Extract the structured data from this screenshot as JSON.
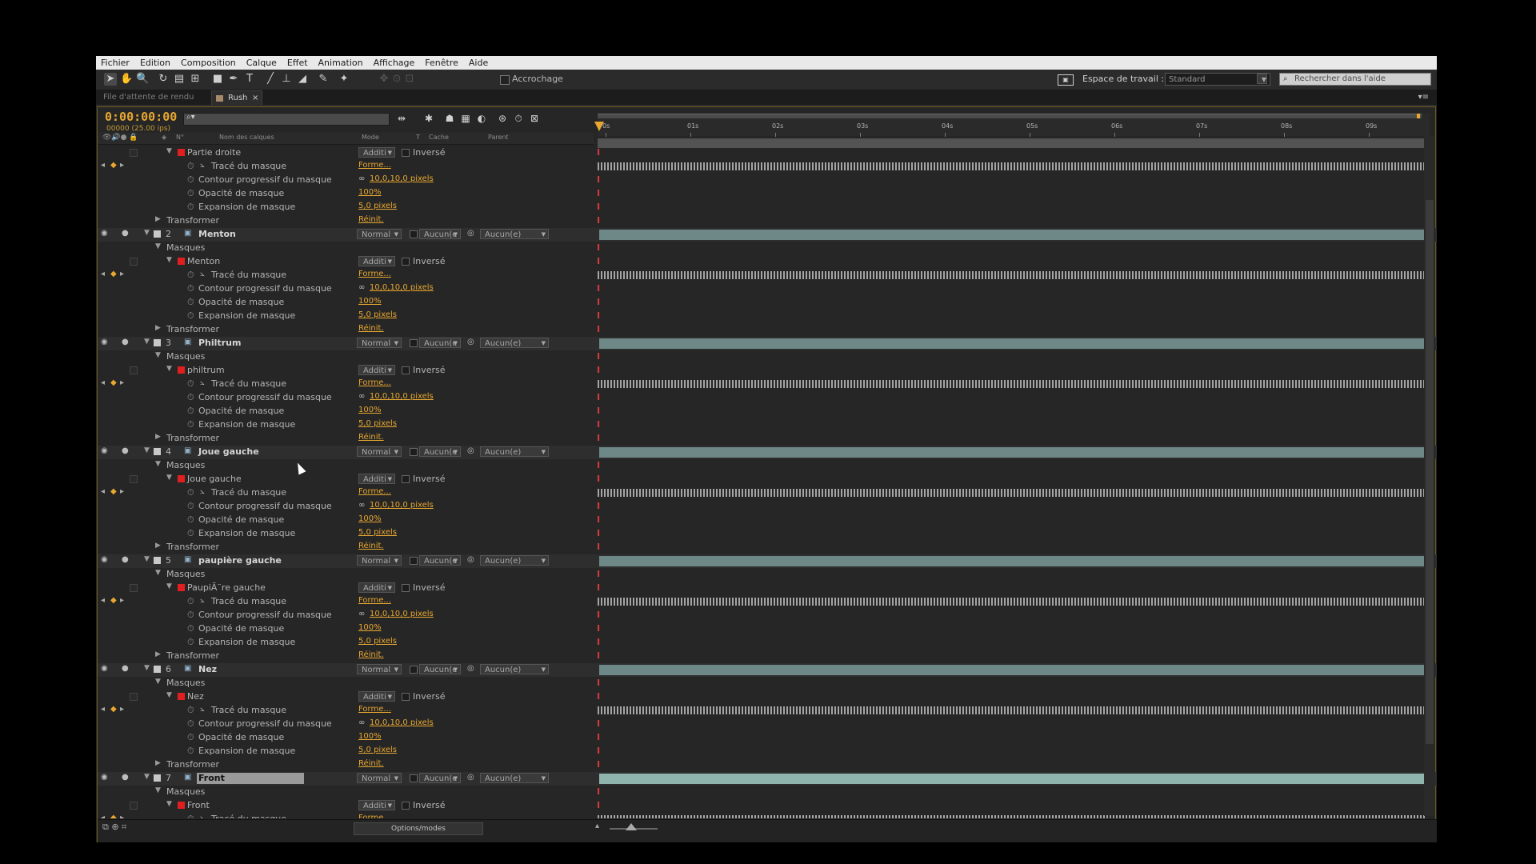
{
  "menu": [
    "Fichier",
    "Edition",
    "Composition",
    "Calque",
    "Effet",
    "Animation",
    "Affichage",
    "Fenêtre",
    "Aide"
  ],
  "toolbar": {
    "snap_label": "Accrochage",
    "workspace_label": "Espace de travail :",
    "workspace_value": "Standard",
    "search_placeholder": "Rechercher dans l'aide"
  },
  "tabs": {
    "render_queue": "File d'attente de rendu",
    "comp": "Rush",
    "close": "×"
  },
  "panel": {
    "timecode": "0:00:00:00",
    "fps": "00000 (25.00 ips)",
    "search_glyph": "⌕▾",
    "columns": {
      "num": "N°",
      "name": "Nom des calques",
      "mode": "Mode",
      "t": "T",
      "mask": "Cache",
      "parent": "Parent"
    },
    "ruler": [
      "0s",
      "01s",
      "02s",
      "03s",
      "04s",
      "05s",
      "06s",
      "07s",
      "08s",
      "09s"
    ],
    "options": "Options/modes"
  },
  "rows": [
    {
      "t": "mask",
      "name": "Partie droite",
      "mode": "Additi",
      "inv": "Inversé"
    },
    {
      "t": "path",
      "name": "Tracé du masque",
      "val": "Forme..."
    },
    {
      "t": "prop",
      "name": "Contour progressif du masque",
      "val": "10,0,10,0 pixels",
      "link": true
    },
    {
      "t": "prop",
      "name": "Opacité de masque",
      "val": "100%"
    },
    {
      "t": "prop",
      "name": "Expansion de masque",
      "val": "5,0 pixels"
    },
    {
      "t": "xf",
      "name": "Transformer",
      "val": "Réinit."
    },
    {
      "t": "layer",
      "num": "2",
      "name": "Menton",
      "mode": "Normal",
      "mask": "Aucun(e",
      "parent": "Aucun(e)"
    },
    {
      "t": "masks",
      "name": "Masques"
    },
    {
      "t": "mask",
      "name": "Menton",
      "mode": "Additi",
      "inv": "Inversé"
    },
    {
      "t": "path",
      "name": "Tracé du masque",
      "val": "Forme..."
    },
    {
      "t": "prop",
      "name": "Contour progressif du masque",
      "val": "10,0,10,0 pixels",
      "link": true
    },
    {
      "t": "prop",
      "name": "Opacité de masque",
      "val": "100%"
    },
    {
      "t": "prop",
      "name": "Expansion de masque",
      "val": "5,0 pixels"
    },
    {
      "t": "xf",
      "name": "Transformer",
      "val": "Réinit."
    },
    {
      "t": "layer",
      "num": "3",
      "name": "Philtrum",
      "mode": "Normal",
      "mask": "Aucun(e",
      "parent": "Aucun(e)"
    },
    {
      "t": "masks",
      "name": "Masques"
    },
    {
      "t": "mask",
      "name": "philtrum",
      "mode": "Additi",
      "inv": "Inversé"
    },
    {
      "t": "path",
      "name": "Tracé du masque",
      "val": "Forme..."
    },
    {
      "t": "prop",
      "name": "Contour progressif du masque",
      "val": "10,0,10,0 pixels",
      "link": true
    },
    {
      "t": "prop",
      "name": "Opacité de masque",
      "val": "100%"
    },
    {
      "t": "prop",
      "name": "Expansion de masque",
      "val": "5,0 pixels"
    },
    {
      "t": "xf",
      "name": "Transformer",
      "val": "Réinit."
    },
    {
      "t": "layer",
      "num": "4",
      "name": "Joue gauche",
      "mode": "Normal",
      "mask": "Aucun(e",
      "parent": "Aucun(e)"
    },
    {
      "t": "masks",
      "name": "Masques"
    },
    {
      "t": "mask",
      "name": "Joue gauche",
      "mode": "Additi",
      "inv": "Inversé"
    },
    {
      "t": "path",
      "name": "Tracé du masque",
      "val": "Forme..."
    },
    {
      "t": "prop",
      "name": "Contour progressif du masque",
      "val": "10,0,10,0 pixels",
      "link": true
    },
    {
      "t": "prop",
      "name": "Opacité de masque",
      "val": "100%"
    },
    {
      "t": "prop",
      "name": "Expansion de masque",
      "val": "5,0 pixels"
    },
    {
      "t": "xf",
      "name": "Transformer",
      "val": "Réinit."
    },
    {
      "t": "layer",
      "num": "5",
      "name": "paupière gauche",
      "mode": "Normal",
      "mask": "Aucun(e",
      "parent": "Aucun(e)"
    },
    {
      "t": "masks",
      "name": "Masques"
    },
    {
      "t": "mask",
      "name": "PaupiÃ¨re gauche",
      "mode": "Additi",
      "inv": "Inversé"
    },
    {
      "t": "path",
      "name": "Tracé du masque",
      "val": "Forme..."
    },
    {
      "t": "prop",
      "name": "Contour progressif du masque",
      "val": "10,0,10,0 pixels",
      "link": true
    },
    {
      "t": "prop",
      "name": "Opacité de masque",
      "val": "100%"
    },
    {
      "t": "prop",
      "name": "Expansion de masque",
      "val": "5,0 pixels"
    },
    {
      "t": "xf",
      "name": "Transformer",
      "val": "Réinit."
    },
    {
      "t": "layer",
      "num": "6",
      "name": "Nez",
      "mode": "Normal",
      "mask": "Aucun(e",
      "parent": "Aucun(e)"
    },
    {
      "t": "masks",
      "name": "Masques"
    },
    {
      "t": "mask",
      "name": "Nez",
      "mode": "Additi",
      "inv": "Inversé"
    },
    {
      "t": "path",
      "name": "Tracé du masque",
      "val": "Forme..."
    },
    {
      "t": "prop",
      "name": "Contour progressif du masque",
      "val": "10,0,10,0 pixels",
      "link": true
    },
    {
      "t": "prop",
      "name": "Opacité de masque",
      "val": "100%"
    },
    {
      "t": "prop",
      "name": "Expansion de masque",
      "val": "5,0 pixels"
    },
    {
      "t": "xf",
      "name": "Transformer",
      "val": "Réinit."
    },
    {
      "t": "layer",
      "num": "7",
      "name": "Front",
      "mode": "Normal",
      "mask": "Aucun(e",
      "parent": "Aucun(e)",
      "selected": true
    },
    {
      "t": "masks",
      "name": "Masques"
    },
    {
      "t": "mask",
      "name": "Front",
      "mode": "Additi",
      "inv": "Inversé"
    },
    {
      "t": "path",
      "name": "Tracé du masque",
      "val": "Forme..."
    }
  ],
  "colors": {
    "accent": "#e7a730",
    "mask": "#e02020",
    "layer_swatch": "#c8c8c8",
    "bar": "#6e8787",
    "bar_selected": "#8fb3ad"
  }
}
